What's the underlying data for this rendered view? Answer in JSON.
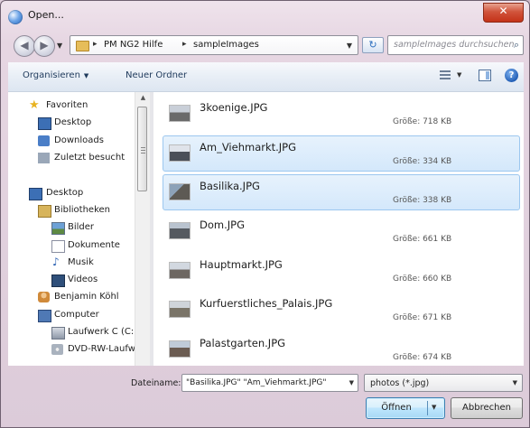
{
  "window": {
    "title": "Open..."
  },
  "nav": {
    "back_icon": "back-arrow-icon",
    "forward_icon": "forward-arrow-icon",
    "breadcrumb": [
      "PM NG2 Hilfe",
      "sampleImages"
    ],
    "search_placeholder": "sampleImages durchsuchen"
  },
  "toolbar": {
    "organize": "Organisieren",
    "new_folder": "Neuer Ordner"
  },
  "sidebar": {
    "items": [
      {
        "label": "Favoriten",
        "icon": "star-icon"
      },
      {
        "label": "Desktop",
        "icon": "desktop-icon"
      },
      {
        "label": "Downloads",
        "icon": "downloads-icon"
      },
      {
        "label": "Zuletzt besucht",
        "icon": "recent-icon"
      },
      {
        "label": "Desktop",
        "icon": "desktop-icon"
      },
      {
        "label": "Bibliotheken",
        "icon": "library-icon"
      },
      {
        "label": "Bilder",
        "icon": "pictures-icon"
      },
      {
        "label": "Dokumente",
        "icon": "documents-icon"
      },
      {
        "label": "Musik",
        "icon": "music-icon"
      },
      {
        "label": "Videos",
        "icon": "videos-icon"
      },
      {
        "label": "Benjamin Köhl",
        "icon": "user-icon"
      },
      {
        "label": "Computer",
        "icon": "computer-icon"
      },
      {
        "label": "Laufwerk C (C:)",
        "icon": "drive-icon"
      },
      {
        "label": "DVD-RW-Laufwerk",
        "icon": "dvd-icon"
      }
    ]
  },
  "files": [
    {
      "name": "3koenige.JPG",
      "size": "Größe: 718 KB",
      "selected": false
    },
    {
      "name": "Am_Viehmarkt.JPG",
      "size": "Größe: 334 KB",
      "selected": true
    },
    {
      "name": "Basilika.JPG",
      "size": "Größe: 338 KB",
      "selected": true
    },
    {
      "name": "Dom.JPG",
      "size": "Größe: 661 KB",
      "selected": false
    },
    {
      "name": "Hauptmarkt.JPG",
      "size": "Größe: 660 KB",
      "selected": false
    },
    {
      "name": "Kurfuerstliches_Palais.JPG",
      "size": "Größe: 671 KB",
      "selected": false
    },
    {
      "name": "Palastgarten.JPG",
      "size": "Größe: 674 KB",
      "selected": false
    }
  ],
  "bottom": {
    "filename_label": "Dateiname:",
    "filename_value": "\"Basilika.JPG\" \"Am_Viehmarkt.JPG\"",
    "filetype": "photos (*.jpg)",
    "open_label": "Öffnen",
    "cancel_label": "Abbrechen"
  }
}
